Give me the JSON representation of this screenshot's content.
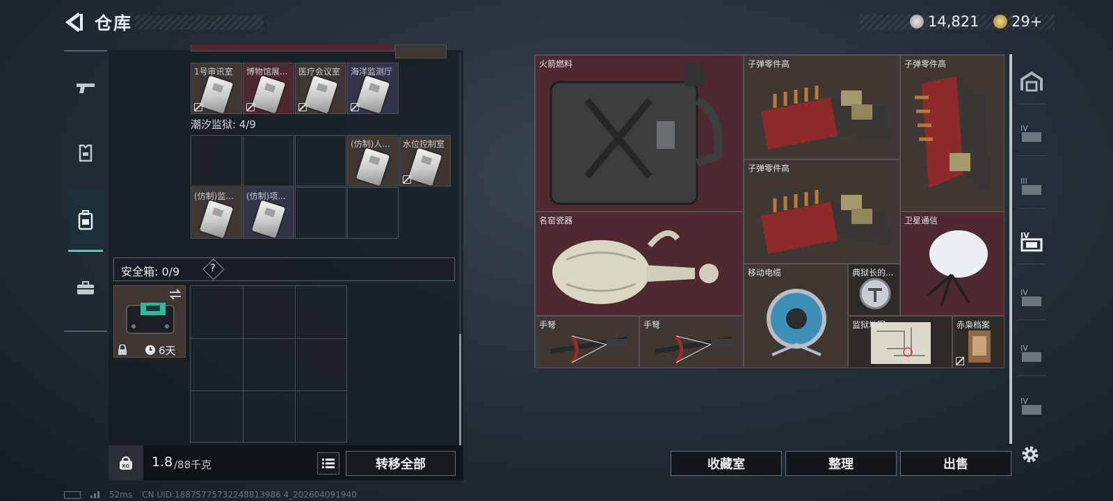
{
  "header": {
    "title": "仓库",
    "silver_amount": "14,821",
    "gold_amount": "29+"
  },
  "left_nav": [
    "weapon-icon",
    "armor-icon",
    "backpack-icon",
    "toolbox-icon"
  ],
  "top_row": {
    "labels": [
      "1号审讯室",
      "博物馆展...",
      "医疗会议室",
      "海洋监测厅"
    ]
  },
  "tide_prison": {
    "label": "潮汐监狱: 4/9",
    "row1_labels": [
      "(仿制)人...",
      "水位控制室"
    ],
    "row2_labels": [
      "(仿制)监...",
      "(仿制)项..."
    ]
  },
  "safe_box": {
    "label": "安全箱: 0/9",
    "help": "?",
    "timer": "6天"
  },
  "weight": {
    "current": "1.8",
    "max_unit": "/88千克",
    "transfer_all": "转移全部"
  },
  "items": {
    "rocket_fuel": "火箭燃料",
    "bullet_parts_1": "子弹零件高",
    "bullet_parts_2": "子弹零件高",
    "bullet_parts_3": "子弹零件高",
    "famous_porcelain": "名窑瓷器",
    "satellite": "卫星通信",
    "cable": "移动电缆",
    "medal": "典狱长的...",
    "crossbow_1": "手弩",
    "crossbow_2": "手弩",
    "prison_map": "监狱地图",
    "red_file": "赤枭档案"
  },
  "buttons": {
    "collection": "收藏室",
    "organize": "整理",
    "sell": "出售"
  },
  "status": {
    "ping": "52ms",
    "uid": "CN UID:18875775732248813986 4_202604091940"
  },
  "colors": {
    "accent": "#4fd0a6",
    "red_slot": "#4e2a30",
    "brown_slot": "#3f3732"
  }
}
